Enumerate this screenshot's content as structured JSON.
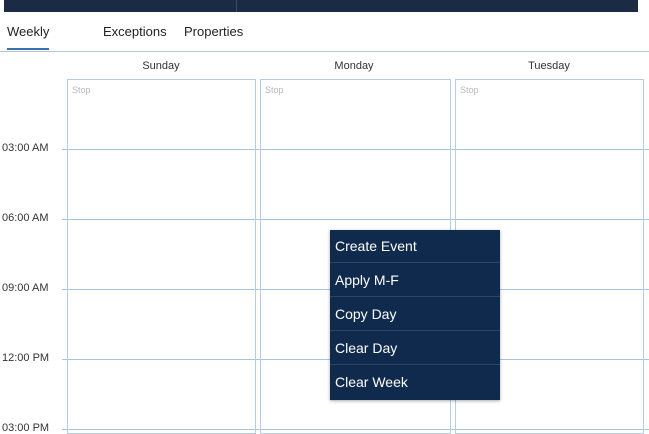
{
  "tabs": [
    {
      "label": "Weekly",
      "active": true
    },
    {
      "label": "Exceptions",
      "active": false
    },
    {
      "label": "Properties",
      "active": false
    }
  ],
  "days": [
    "Sunday",
    "Monday",
    "Tuesday"
  ],
  "day_state_label": "Stop",
  "time_labels": [
    "03:00 AM",
    "06:00 AM",
    "09:00 AM",
    "12:00 PM",
    "03:00 PM"
  ],
  "context_menu": {
    "items": [
      "Create Event",
      "Apply M-F",
      "Copy Day",
      "Clear Day",
      "Clear Week"
    ]
  },
  "colors": {
    "header_bar": "#1b2b45",
    "menu_background": "#0f2a4d",
    "active_tab_underline": "#3a6fb0",
    "grid_line": "#b7cde3"
  }
}
